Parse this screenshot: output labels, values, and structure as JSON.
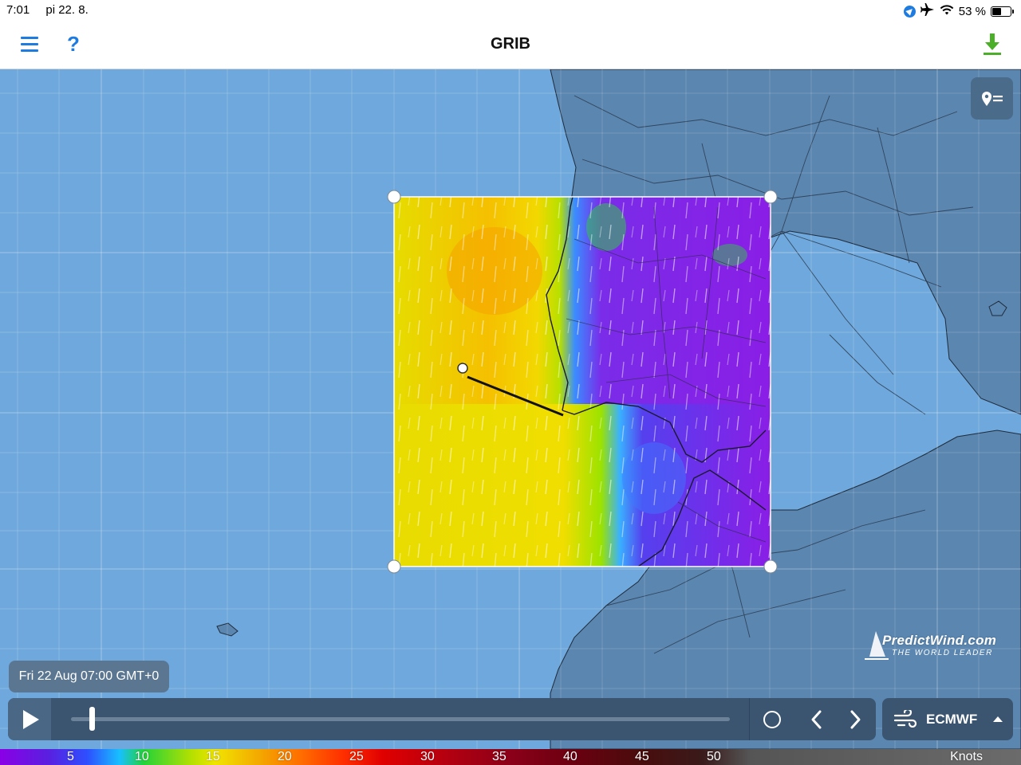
{
  "status_bar": {
    "time": "7:01",
    "date": "pi 22. 8.",
    "battery": "53 %",
    "icons": [
      "location-icon",
      "airplane-icon",
      "wifi-icon",
      "battery-icon"
    ]
  },
  "nav": {
    "title": "GRIB",
    "left_icons": [
      "menu-icon",
      "help-icon"
    ],
    "right_icon": "download-icon",
    "help_label": "?"
  },
  "map": {
    "watermark_brand": "PredictWind.com",
    "watermark_tag": "THE WORLD LEADER",
    "layers_icon": "pin-list-icon"
  },
  "timeline": {
    "time_label": "Fri 22 Aug 07:00 GMT+0",
    "position": 0.02,
    "play_icon": "play-icon",
    "now_icon": "circle-icon",
    "prev_icon": "chevron-left-icon",
    "next_icon": "chevron-right-icon"
  },
  "model": {
    "label": "ECMWF",
    "icon": "wind-icon",
    "caret_icon": "caret-up-icon"
  },
  "legend": {
    "ticks": [
      "5",
      "10",
      "15",
      "20",
      "25",
      "30",
      "35",
      "40",
      "45",
      "50"
    ],
    "unit": "Knots"
  },
  "colors": {
    "accent_blue": "#1e7be0",
    "download_green": "#4caf2a",
    "sea": "#6fa8dc",
    "land": "#5a86b0",
    "control_bg": "#3b5570"
  }
}
